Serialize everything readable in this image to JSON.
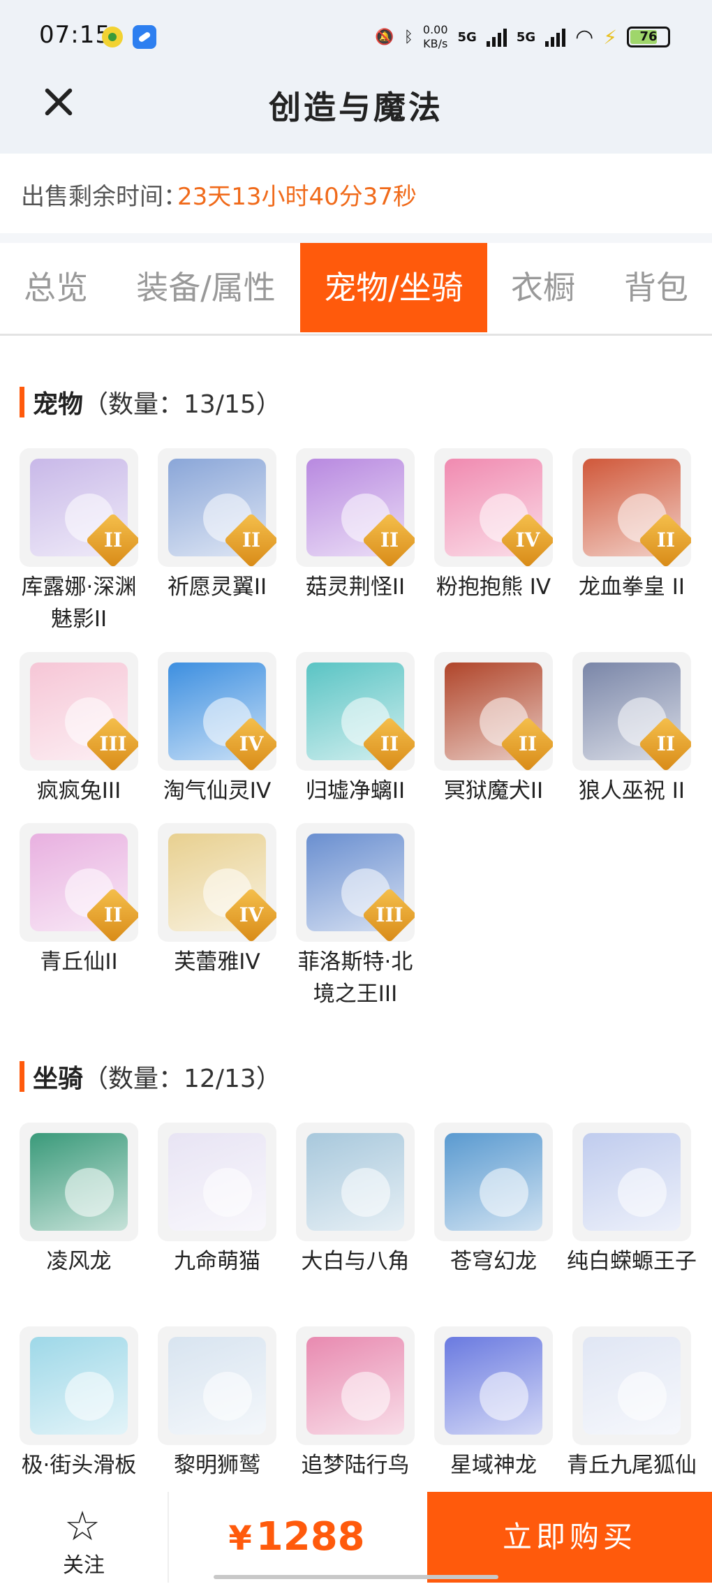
{
  "status_bar": {
    "time": "07:15",
    "net_speed": "0.00",
    "net_unit": "KB/s",
    "signal1": "5G",
    "signal2": "5G",
    "battery": "76"
  },
  "header": {
    "title": "创造与魔法"
  },
  "timer": {
    "label": "出售剩余时间：",
    "value": "23天13小时40分37秒"
  },
  "tabs": [
    {
      "label": "总览"
    },
    {
      "label": "装备/属性"
    },
    {
      "label": "宠物/坐骑"
    },
    {
      "label": "衣橱"
    },
    {
      "label": "背包"
    }
  ],
  "pets": {
    "title": "宠物",
    "count": "（数量：13/15）",
    "items": [
      {
        "name": "库露娜·深渊魅影II",
        "badge": "II",
        "color": "#c8b8e8"
      },
      {
        "name": "祈愿灵翼II",
        "badge": "II",
        "color": "#8aa6d8"
      },
      {
        "name": "菇灵荆怪II",
        "badge": "II",
        "color": "#b889e0"
      },
      {
        "name": "粉抱抱熊 IV",
        "badge": "IV",
        "color": "#f08ab0"
      },
      {
        "name": "龙血拳皇 II",
        "badge": "II",
        "color": "#d0583a"
      },
      {
        "name": "疯疯兔III",
        "badge": "III",
        "color": "#f6c6d6"
      },
      {
        "name": "淘气仙灵IV",
        "badge": "IV",
        "color": "#3d8fe0"
      },
      {
        "name": "归墟净螭II",
        "badge": "II",
        "color": "#5ac4c4"
      },
      {
        "name": "冥狱魔犬II",
        "badge": "II",
        "color": "#b0452a"
      },
      {
        "name": "狼人巫祝 II",
        "badge": "II",
        "color": "#7a86a8"
      },
      {
        "name": "青丘仙II",
        "badge": "II",
        "color": "#e8b0e0"
      },
      {
        "name": "芙蕾雅IV",
        "badge": "IV",
        "color": "#e8d090"
      },
      {
        "name": "菲洛斯特·北境之王III",
        "badge": "III",
        "color": "#6a8fd0"
      }
    ]
  },
  "mounts": {
    "title": "坐骑",
    "count": "（数量：12/13）",
    "items": [
      {
        "name": "凌风龙",
        "color": "#3a9a7a"
      },
      {
        "name": "九命萌猫",
        "color": "#e8e4f4"
      },
      {
        "name": "大白与八角",
        "color": "#a8c8dc"
      },
      {
        "name": "苍穹幻龙",
        "color": "#5a9ad0"
      },
      {
        "name": "纯白蝾螈王子",
        "color": "#c0ccee"
      },
      {
        "name": "极·街头滑板",
        "color": "#9ed8e8"
      },
      {
        "name": "黎明狮鹫",
        "color": "#d8e4f0"
      },
      {
        "name": "追梦陆行鸟",
        "color": "#e88ab0"
      },
      {
        "name": "星域神龙",
        "color": "#6a7ae0"
      },
      {
        "name": "青丘九尾狐仙",
        "color": "#e0e6f4"
      }
    ]
  },
  "bottom": {
    "follow_label": "关注",
    "star_icon": "star-outline-icon",
    "currency": "¥",
    "price": "1288",
    "buy_label": "立即购买"
  },
  "colors": {
    "accent": "#ff5a0c",
    "timer": "#f06a1a"
  }
}
